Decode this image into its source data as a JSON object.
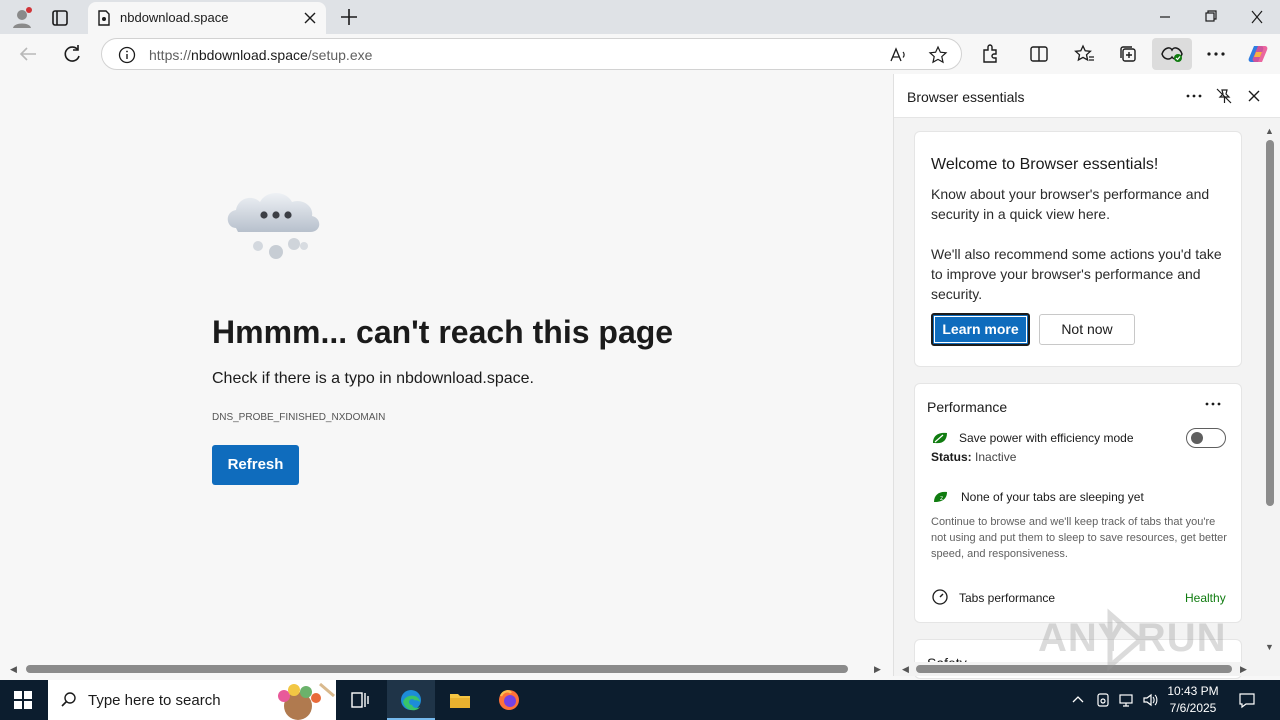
{
  "browser": {
    "tab_title": "nbdownload.space",
    "url_prefix": "https://",
    "url_host": "nbdownload.space",
    "url_path": "/setup.exe"
  },
  "page": {
    "title": "Hmmm... can't reach this page",
    "subtitle": "Check if there is a typo in nbdownload.space.",
    "error_code": "DNS_PROBE_FINISHED_NXDOMAIN",
    "refresh_label": "Refresh"
  },
  "panel": {
    "title": "Browser essentials",
    "welcome": {
      "title": "Welcome to Browser essentials!",
      "body1": "Know about your browser's performance and security in a quick view here.",
      "body2": "We'll also recommend some actions you'd take to improve your browser's performance and security.",
      "learn_more": "Learn more",
      "not_now": "Not now"
    },
    "performance": {
      "title": "Performance",
      "efficiency_label": "Save power with efficiency mode",
      "status_label": "Status:",
      "status_value": "Inactive",
      "sleeping_label": "None of your tabs are sleeping yet",
      "sleeping_desc": "Continue to browse and we'll keep track of tabs that you're not using and put them to sleep to save resources, get better speed, and responsiveness.",
      "tabs_perf_label": "Tabs performance",
      "tabs_perf_value": "Healthy",
      "efficiency_on": false
    },
    "safety": {
      "title": "Safety"
    }
  },
  "watermark": {
    "text": "ANY RUN"
  },
  "taskbar": {
    "search_placeholder": "Type here to search",
    "time": "10:43 PM",
    "date": "7/6/2025"
  },
  "colors": {
    "accent": "#0f6cbd",
    "healthy": "#107c10",
    "taskbar": "#0c1d2e"
  }
}
